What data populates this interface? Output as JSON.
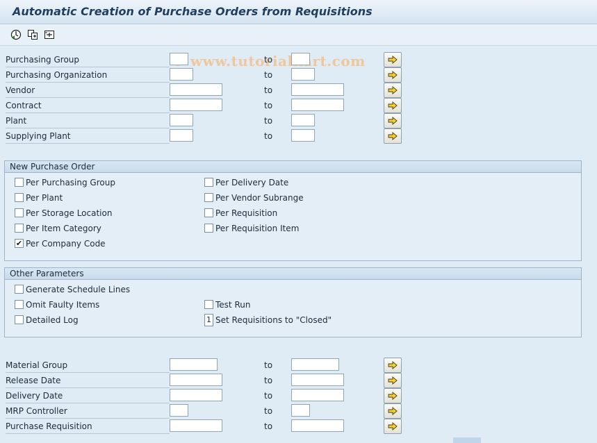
{
  "title": "Automatic Creation of Purchase Orders from Requisitions",
  "toolbar": {
    "icons": [
      "execute-icon",
      "copy-variant-icon",
      "selection-options-icon"
    ]
  },
  "watermark": "© www.tutorialkart.com",
  "to_label": "to",
  "selection_top": [
    {
      "label": "Purchasing Group"
    },
    {
      "label": "Purchasing Organization"
    },
    {
      "label": "Vendor"
    },
    {
      "label": "Contract"
    },
    {
      "label": "Plant"
    },
    {
      "label": "Supplying Plant"
    }
  ],
  "new_po": {
    "heading": "New Purchase Order",
    "left": [
      {
        "label": "Per Purchasing Group",
        "checked": false
      },
      {
        "label": "Per Plant",
        "checked": false
      },
      {
        "label": "Per Storage Location",
        "checked": false
      },
      {
        "label": "Per Item Category",
        "checked": false
      },
      {
        "label": "Per Company Code",
        "checked": true
      }
    ],
    "right": [
      {
        "label": "Per Delivery Date",
        "checked": false
      },
      {
        "label": "Per Vendor Subrange",
        "checked": false
      },
      {
        "label": "Per Requisition",
        "checked": false
      },
      {
        "label": "Per Requisition Item",
        "checked": false
      }
    ]
  },
  "other": {
    "heading": "Other Parameters",
    "generate_schedule": {
      "label": "Generate Schedule Lines",
      "checked": false
    },
    "omit_faulty": {
      "label": "Omit Faulty Items",
      "checked": false
    },
    "detailed_log": {
      "label": "Detailed Log",
      "checked": false
    },
    "test_run": {
      "label": "Test Run",
      "checked": false
    },
    "set_closed": {
      "value": "1",
      "label": "Set Requisitions to \"Closed\""
    }
  },
  "selection_bottom": [
    {
      "label": "Material Group"
    },
    {
      "label": "Release Date"
    },
    {
      "label": "Delivery Date"
    },
    {
      "label": "MRP Controller"
    },
    {
      "label": "Purchase Requisition"
    }
  ]
}
